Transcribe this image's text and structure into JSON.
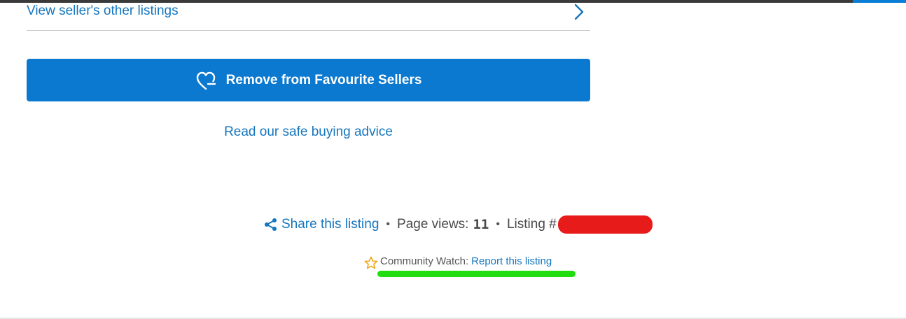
{
  "seller": {
    "other_listings_label": "View seller's other listings"
  },
  "favourite_button": {
    "label": "Remove from Favourite Sellers"
  },
  "safe_buying": {
    "label": "Read our safe buying advice"
  },
  "listing_meta": {
    "share_label": "Share this listing",
    "separator": "•",
    "page_views_label": "Page views:",
    "page_views_value": "11",
    "listing_label": "Listing #"
  },
  "community": {
    "label": "Community Watch:",
    "report_label": "Report this listing"
  },
  "colors": {
    "primary": "#0b79cf",
    "link": "#1576be",
    "redaction": "#e81b1b",
    "highlight": "#22dd10",
    "star": "#f2a81d"
  },
  "icons": [
    "chevron-right-icon",
    "heart-icon",
    "share-icon",
    "star-icon"
  ]
}
